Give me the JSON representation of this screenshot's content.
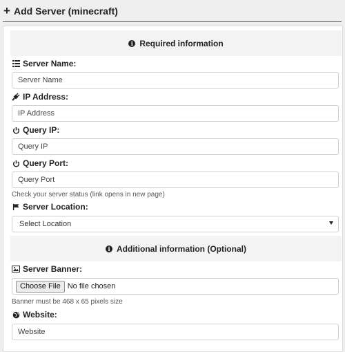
{
  "header": {
    "title": "Add Server (minecraft)"
  },
  "sections": {
    "required": "Required information",
    "additional": "Additional information (Optional)"
  },
  "fields": {
    "server_name": {
      "label": "Server Name:",
      "placeholder": "Server Name",
      "icon": "server-list-icon"
    },
    "ip_address": {
      "label": "IP Address:",
      "placeholder": "IP Address",
      "icon": "plug-icon"
    },
    "query_ip": {
      "label": "Query IP:",
      "placeholder": "Query IP",
      "icon": "power-icon"
    },
    "query_port": {
      "label": "Query Port:",
      "placeholder": "Query Port",
      "icon": "power-icon",
      "help": "Check your server status (link opens in new page)"
    },
    "server_location": {
      "label": "Server Location:",
      "selected": "Select Location",
      "icon": "flag-icon"
    },
    "server_banner": {
      "label": "Server Banner:",
      "button": "Choose File",
      "status": "No file chosen",
      "help": "Banner must be 468 x 65 pixels size",
      "icon": "image-icon"
    },
    "website": {
      "label": "Website:",
      "placeholder": "Website",
      "icon": "globe-icon"
    }
  },
  "colors": {
    "background": "#efefef",
    "card": "#ffffff",
    "section_head": "#f3f3f3"
  }
}
